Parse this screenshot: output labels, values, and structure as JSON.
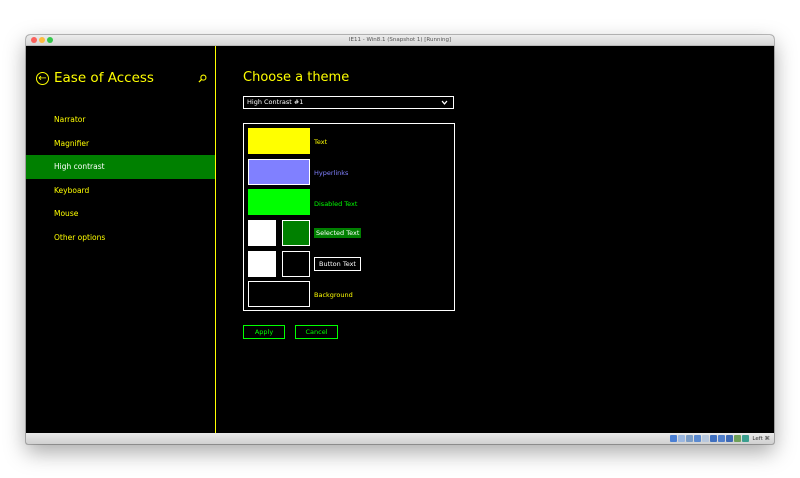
{
  "window": {
    "title": "IE11 - Win8.1 (Snapshot 1) [Running]"
  },
  "sidebar": {
    "title": "Ease of Access",
    "items": [
      {
        "label": "Narrator",
        "active": false
      },
      {
        "label": "Magnifier",
        "active": false
      },
      {
        "label": "High contrast",
        "active": true
      },
      {
        "label": "Keyboard",
        "active": false
      },
      {
        "label": "Mouse",
        "active": false
      },
      {
        "label": "Other options",
        "active": false
      }
    ]
  },
  "main": {
    "title": "Choose a theme",
    "theme_select": {
      "value": "High Contrast #1"
    },
    "swatches": {
      "text": {
        "label": "Text",
        "color": "#ffff00"
      },
      "hyperlinks": {
        "label": "Hyperlinks",
        "color": "#8080ff"
      },
      "disabled": {
        "label": "Disabled Text",
        "color": "#00ff00"
      },
      "selected": {
        "label": "Selected Text",
        "fg": "#ffffff",
        "bg": "#008000"
      },
      "button": {
        "label": "Button Text",
        "fg": "#ffffff",
        "bg": "#000000"
      },
      "background": {
        "label": "Background",
        "color": "#000000"
      }
    },
    "buttons": {
      "apply": "Apply",
      "cancel": "Cancel"
    }
  },
  "statusbar": {
    "host_key": "Left ⌘"
  },
  "colors": {
    "accent": "#ffff00",
    "active_nav": "#008000",
    "button": "#00ff00"
  }
}
